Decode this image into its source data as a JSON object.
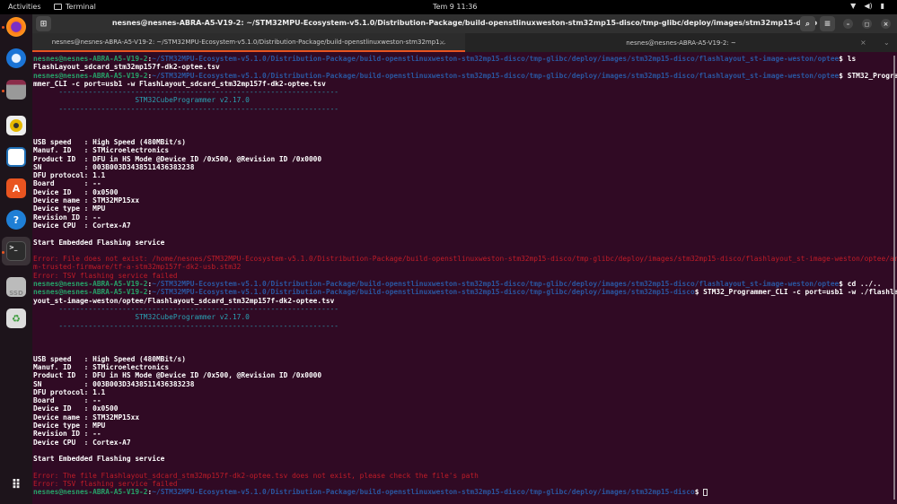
{
  "topbar": {
    "activities": "Activities",
    "app": "Terminal",
    "clock": "Tem 9  11:36",
    "tray": [
      "wifi-icon",
      "volume-icon",
      "battery-icon"
    ]
  },
  "dock": [
    "firefox",
    "thunderbird",
    "files",
    "rhythmbox",
    "libreoffice-writer",
    "app-center",
    "help",
    "terminal",
    "ssd",
    "trash",
    "show-apps"
  ],
  "dock_ssd_label": "SSD",
  "window": {
    "title": "nesnes@nesnes-ABRA-A5-V19-2: ~/STM32MPU-Ecosystem-v5.1.0/Distribution-Package/build-openstlinuxweston-stm32mp15-disco/tmp-glibc/deploy/images/stm32mp15-disco"
  },
  "tabs": [
    {
      "label": "nesnes@nesnes-ABRA-A5-V19-2: ~/STM32MPU-Ecosystem-v5.1.0/Distribution-Package/build-openstlinuxweston-stm32mp1..."
    },
    {
      "label": "nesnes@nesnes-ABRA-A5-V19-2: ~"
    }
  ],
  "accent": "#e95420",
  "terminal": {
    "lines": [
      {
        "u": "nesnes@nesnes-ABRA-A5-V19-2",
        "p": "~/STM32MPU-Ecosystem-v5.1.0/Distribution-Package/build-openstlinuxweston-stm32mp15-disco/tmp-glibc/deploy/images/stm32mp15-disco/flashlayout_st-image-weston/optee",
        "c": " ls"
      },
      {
        "t": "FlashLayout_sdcard_stm32mp157f-dk2-optee.tsv"
      },
      {
        "u": "nesnes@nesnes-ABRA-A5-V19-2",
        "p": "~/STM32MPU-Ecosystem-v5.1.0/Distribution-Package/build-openstlinuxweston-stm32mp15-disco/tmp-glibc/deploy/images/stm32mp15-disco/flashlayout_st-image-weston/optee",
        "c": " STM32_Progra"
      },
      {
        "t": "mmer_CLI -c port=usb1 -w FlashLayout_sdcard_stm32mp157f-dk2-optee.tsv"
      },
      {
        "t": "      ------------------------------------------------------------------",
        "s": "cy"
      },
      {
        "t": "                        STM32CubeProgrammer v2.17.0",
        "s": "cy"
      },
      {
        "t": "      ------------------------------------------------------------------",
        "s": "cy"
      },
      {
        "t": ""
      },
      {
        "t": ""
      },
      {
        "t": ""
      },
      {
        "t": "USB speed   : High Speed (480MBit/s)"
      },
      {
        "t": "Manuf. ID   : STMicroelectronics"
      },
      {
        "t": "Product ID  : DFU in HS Mode @Device ID /0x500, @Revision ID /0x0000"
      },
      {
        "t": "SN          : 003B003D3438511436383238"
      },
      {
        "t": "DFU protocol: 1.1"
      },
      {
        "t": "Board       : --"
      },
      {
        "t": "Device ID   : 0x0500"
      },
      {
        "t": "Device name : STM32MP15xx"
      },
      {
        "t": "Device type : MPU"
      },
      {
        "t": "Revision ID : --"
      },
      {
        "t": "Device CPU  : Cortex-A7"
      },
      {
        "t": ""
      },
      {
        "t": "Start Embedded Flashing service"
      },
      {
        "t": ""
      },
      {
        "t": "Error: File does not exist: /home/nesnes/STM32MPU-Ecosystem-v5.1.0/Distribution-Package/build-openstlinuxweston-stm32mp15-disco/tmp-glibc/deploy/images/stm32mp15-disco/flashlayout_st-image-weston/optee/ar",
        "s": "err"
      },
      {
        "t": "m-trusted-firmware/tf-a-stm32mp157f-dk2-usb.stm32",
        "s": "err"
      },
      {
        "t": "Error: TSV flashing service failed",
        "s": "err"
      },
      {
        "u": "nesnes@nesnes-ABRA-A5-V19-2",
        "p": "~/STM32MPU-Ecosystem-v5.1.0/Distribution-Package/build-openstlinuxweston-stm32mp15-disco/tmp-glibc/deploy/images/stm32mp15-disco/flashlayout_st-image-weston/optee",
        "c": " cd ../.."
      },
      {
        "u": "nesnes@nesnes-ABRA-A5-V19-2",
        "p": "~/STM32MPU-Ecosystem-v5.1.0/Distribution-Package/build-openstlinuxweston-stm32mp15-disco/tmp-glibc/deploy/images/stm32mp15-disco",
        "c": " STM32_Programmer_CLI -c port=usb1 -w ./flashla"
      },
      {
        "t": "yout_st-image-weston/optee/Flashlayout_sdcard_stm32mp157f-dk2-optee.tsv"
      },
      {
        "t": "      ------------------------------------------------------------------",
        "s": "cy"
      },
      {
        "t": "                        STM32CubeProgrammer v2.17.0",
        "s": "cy"
      },
      {
        "t": "      ------------------------------------------------------------------",
        "s": "cy"
      },
      {
        "t": ""
      },
      {
        "t": ""
      },
      {
        "t": ""
      },
      {
        "t": "USB speed   : High Speed (480MBit/s)"
      },
      {
        "t": "Manuf. ID   : STMicroelectronics"
      },
      {
        "t": "Product ID  : DFU in HS Mode @Device ID /0x500, @Revision ID /0x0000"
      },
      {
        "t": "SN          : 003B003D3438511436383238"
      },
      {
        "t": "DFU protocol: 1.1"
      },
      {
        "t": "Board       : --"
      },
      {
        "t": "Device ID   : 0x0500"
      },
      {
        "t": "Device name : STM32MP15xx"
      },
      {
        "t": "Device type : MPU"
      },
      {
        "t": "Revision ID : --"
      },
      {
        "t": "Device CPU  : Cortex-A7"
      },
      {
        "t": ""
      },
      {
        "t": "Start Embedded Flashing service"
      },
      {
        "t": ""
      },
      {
        "t": "Error: The file Flashlayout_sdcard_stm32mp157f-dk2-optee.tsv does not exist, please check the file's path",
        "s": "err"
      },
      {
        "t": "Error: TSV flashing service failed",
        "s": "err"
      },
      {
        "u": "nesnes@nesnes-ABRA-A5-V19-2",
        "p": "~/STM32MPU-Ecosystem-v5.1.0/Distribution-Package/build-openstlinuxweston-stm32mp15-disco/tmp-glibc/deploy/images/stm32mp15-disco",
        "c": " ",
        "cursor": true
      }
    ]
  }
}
